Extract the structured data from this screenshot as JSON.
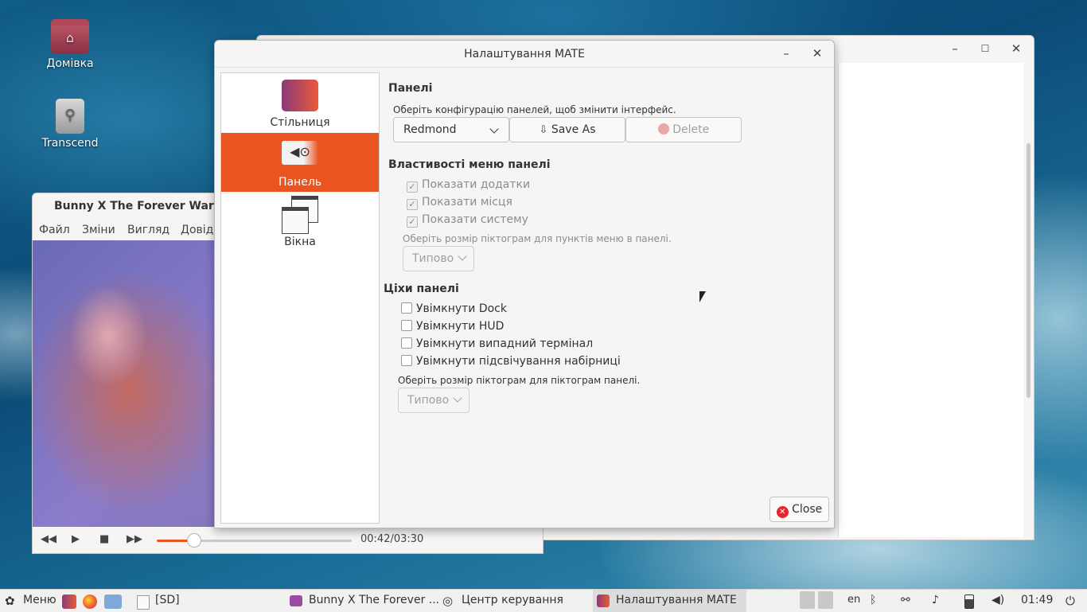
{
  "desktop": {
    "icons": [
      {
        "label": "Домівка"
      },
      {
        "label": "Transcend"
      }
    ]
  },
  "player": {
    "title": "Bunny X The Forever War Offi",
    "menu": [
      "Файл",
      "Зміни",
      "Вигляд",
      "Довід"
    ],
    "time": "00:42/03:30"
  },
  "dialog": {
    "title": "Налаштування MATE",
    "sidebar": [
      {
        "label": "Стільниця",
        "icon": "desktop-icon"
      },
      {
        "label": "Панель",
        "icon": "panel-icon"
      },
      {
        "label": "Вікна",
        "icon": "windows-icon"
      }
    ],
    "panels": {
      "title": "Панелі",
      "hint": "Оберіть конфігурацію панелей, щоб змінити інтерфейс.",
      "layout_value": "Redmond",
      "save_as": "Save As",
      "delete": "Delete"
    },
    "menu_props": {
      "title": "Властивості меню панелі",
      "show_apps": "Показати додатки",
      "show_places": "Показати місця",
      "show_system": "Показати систему",
      "icon_size_hint": "Оберіть розмір піктограм для пунктів меню в панелі.",
      "icon_size_value": "Типово"
    },
    "features": {
      "title": "Ціхи панелі",
      "dock": "Увімкнути Dock",
      "hud": "Увімкнути HUD",
      "dropdown_terminal": "Увімкнути випадний термінал",
      "keyboard_led": "Увімкнути підсвічування набірниці",
      "icon_size_hint": "Оберіть розмір піктограм для піктограм панелі.",
      "icon_size_value": "Типово"
    },
    "close_label": "Close"
  },
  "taskbar": {
    "menu_label": "Меню",
    "sd_label": "[SD]",
    "tasks": [
      {
        "label": "Bunny X The Forever ..."
      },
      {
        "label": "Центр керування"
      },
      {
        "label": "Налаштування MATE"
      }
    ],
    "lang": "en",
    "clock": "01:49"
  },
  "colors": {
    "accent": "#e95420",
    "close_red": "#e0282e"
  }
}
